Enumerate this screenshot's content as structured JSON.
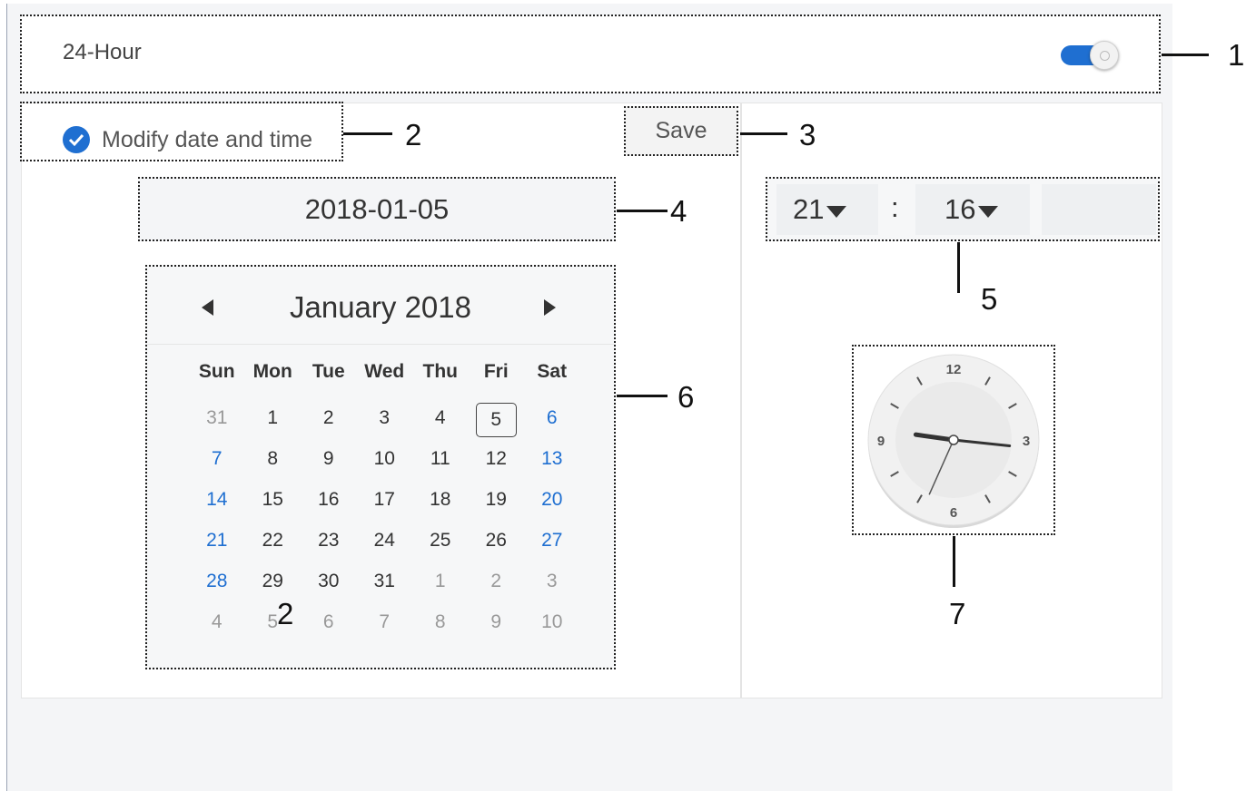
{
  "settings": {
    "hour_format_label": "24-Hour",
    "hour_format_on": true,
    "modify_label": "Modify date and time",
    "modify_checked": true,
    "save_label": "Save"
  },
  "date_field": {
    "value": "2018-01-05"
  },
  "time_field": {
    "hour": "21",
    "separator": ":",
    "minute": "16"
  },
  "calendar": {
    "month_title": "January 2018",
    "weekdays": [
      "Sun",
      "Mon",
      "Tue",
      "Wed",
      "Thu",
      "Fri",
      "Sat"
    ],
    "selected_day": "5",
    "weeks": [
      [
        "31",
        "1",
        "2",
        "3",
        "4",
        "5",
        "6"
      ],
      [
        "7",
        "8",
        "9",
        "10",
        "11",
        "12",
        "13"
      ],
      [
        "14",
        "15",
        "16",
        "17",
        "18",
        "19",
        "20"
      ],
      [
        "21",
        "22",
        "23",
        "24",
        "25",
        "26",
        "27"
      ],
      [
        "28",
        "29",
        "30",
        "31",
        "1",
        "2",
        "3"
      ],
      [
        "4",
        "5",
        "6",
        "7",
        "8",
        "9",
        "10"
      ]
    ]
  },
  "clock": {
    "hours": 21,
    "minutes": 16,
    "numerals": [
      "12",
      "3",
      "6",
      "9"
    ]
  },
  "callouts": [
    "1",
    "2",
    "3",
    "4",
    "5",
    "6",
    "7"
  ],
  "stray_label": "2",
  "colors": {
    "accent": "#1f6fd1",
    "panel_bg": "#f4f5f7"
  },
  "icons": {
    "prev": "triangle-left-icon",
    "next": "triangle-right-icon",
    "check": "check-circle-icon",
    "dropdown": "caret-down-icon"
  }
}
